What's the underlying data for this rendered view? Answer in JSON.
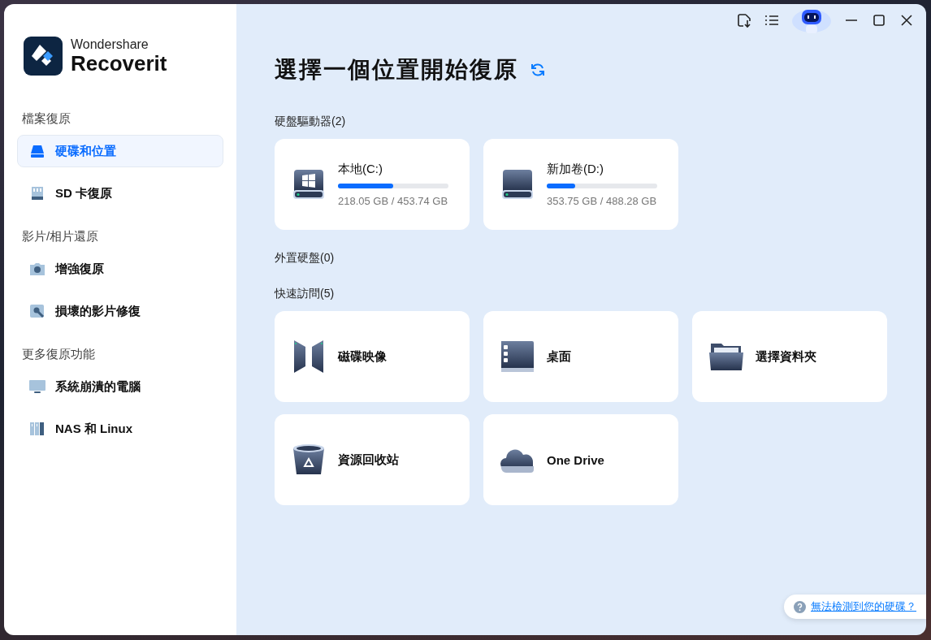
{
  "brand": {
    "company": "Wondershare",
    "product": "Recoverit"
  },
  "sidebar": {
    "sections": [
      {
        "heading": "檔案復原",
        "items": [
          {
            "label": "硬碟和位置",
            "kind": "drive",
            "selected": true
          },
          {
            "label": "SD 卡復原",
            "kind": "sd",
            "selected": false
          }
        ]
      },
      {
        "heading": "影片/相片還原",
        "items": [
          {
            "label": "增強復原",
            "kind": "camera",
            "selected": false
          },
          {
            "label": "損壞的影片修復",
            "kind": "repair",
            "selected": false
          }
        ]
      },
      {
        "heading": "更多復原功能",
        "items": [
          {
            "label": "系統崩潰的電腦",
            "kind": "monitor",
            "selected": false
          },
          {
            "label": "NAS 和 Linux",
            "kind": "nas",
            "selected": false
          }
        ]
      }
    ]
  },
  "main": {
    "title": "選擇一個位置開始復原",
    "groups": [
      {
        "heading": "硬盤驅動器(2)",
        "cards": [
          {
            "kind": "drive_windows",
            "name": "本地(C:)",
            "level": 0.5,
            "reading": "218.05 GB / 453.74 GB"
          },
          {
            "kind": "drive",
            "name": "新加卷(D:)",
            "level": 0.26,
            "reading": "353.75 GB / 488.28 GB"
          }
        ]
      },
      {
        "heading": "外置硬盤(0)"
      },
      {
        "heading": "快速訪問(5)",
        "cards": [
          {
            "kind": "disk_image",
            "name": "磁碟映像"
          },
          {
            "kind": "desktop",
            "name": "桌面"
          },
          {
            "kind": "folder",
            "name": "選擇資料夾"
          },
          {
            "kind": "recycle_bin",
            "name": "資源回收站"
          },
          {
            "kind": "cloud",
            "name": "One Drive"
          }
        ]
      }
    ]
  },
  "help_link": "無法檢測到您的硬碟？"
}
